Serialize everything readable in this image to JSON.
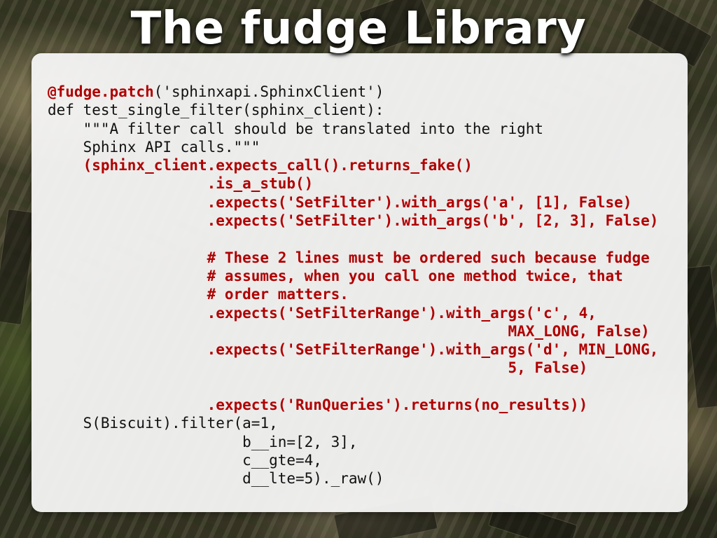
{
  "slide": {
    "title": "The fudge Library"
  },
  "colors": {
    "code_text": "#111111",
    "code_highlight": "#b00000",
    "panel_background": "#f6f6f6",
    "title_text": "#ffffff"
  },
  "code": {
    "lines": [
      {
        "indent": "",
        "hl": "@fudge.patch",
        "text": "('sphinxapi.SphinxClient')"
      },
      {
        "indent": "",
        "hl": "",
        "text": "def test_single_filter(sphinx_client):"
      },
      {
        "indent": "    ",
        "hl": "",
        "text": "\"\"\"A filter call should be translated into the right"
      },
      {
        "indent": "    ",
        "hl": "",
        "text": "Sphinx API calls.\"\"\""
      },
      {
        "indent": "    ",
        "hl": "(sphinx_client.expects_call().returns_fake()",
        "text": ""
      },
      {
        "indent": "                  ",
        "hl": ".is_a_stub()",
        "text": ""
      },
      {
        "indent": "                  ",
        "hl": ".expects('SetFilter').with_args('a', [1], False)",
        "text": ""
      },
      {
        "indent": "                  ",
        "hl": ".expects('SetFilter').with_args('b', [2, 3], False)",
        "text": ""
      },
      {
        "indent": "",
        "hl": "",
        "text": ""
      },
      {
        "indent": "                  ",
        "hl": "# These 2 lines must be ordered such because fudge",
        "text": ""
      },
      {
        "indent": "                  ",
        "hl": "# assumes, when you call one method twice, that",
        "text": ""
      },
      {
        "indent": "                  ",
        "hl": "# order matters.",
        "text": ""
      },
      {
        "indent": "                  ",
        "hl": ".expects('SetFilterRange').with_args('c', 4,",
        "text": ""
      },
      {
        "indent": "                                                    ",
        "hl": "MAX_LONG, False)",
        "text": ""
      },
      {
        "indent": "                  ",
        "hl": ".expects('SetFilterRange').with_args('d', MIN_LONG,",
        "text": ""
      },
      {
        "indent": "                                                    ",
        "hl": "5, False)",
        "text": ""
      },
      {
        "indent": "",
        "hl": "",
        "text": ""
      },
      {
        "indent": "                  ",
        "hl": ".expects('RunQueries').returns(no_results))",
        "text": ""
      },
      {
        "indent": "    ",
        "hl": "",
        "text": "S(Biscuit).filter(a=1,"
      },
      {
        "indent": "                      ",
        "hl": "",
        "text": "b__in=[2, 3],"
      },
      {
        "indent": "                      ",
        "hl": "",
        "text": "c__gte=4,"
      },
      {
        "indent": "                      ",
        "hl": "",
        "text": "d__lte=5)._raw()"
      }
    ]
  }
}
